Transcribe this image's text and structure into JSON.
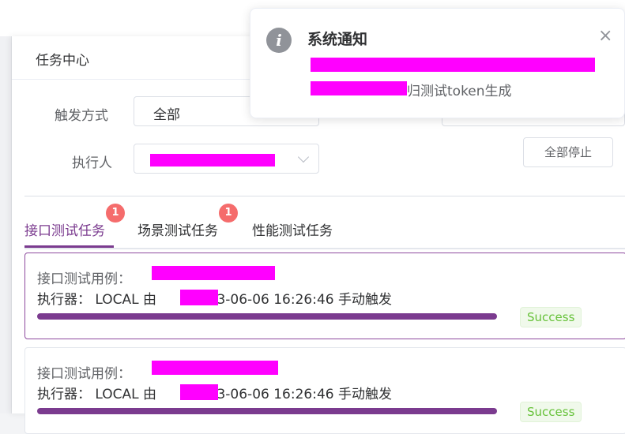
{
  "drawer": {
    "title": "任务中心",
    "filters": {
      "trigger_label": "触发方式",
      "trigger_value": "全部",
      "executor_label": "执行人",
      "executor_value": ""
    },
    "stop_all_label": "全部停止"
  },
  "tabs": [
    {
      "label": "接口测试任务",
      "badge": "1",
      "active": true
    },
    {
      "label": "场景测试任务",
      "badge": "1",
      "active": false
    },
    {
      "label": "性能测试任务",
      "badge": "",
      "active": false
    }
  ],
  "tasks": [
    {
      "case_label": "接口测试用例：",
      "executor_prefix": "执行器：  LOCAL 由",
      "executor_suffix": "2023-06-06 16:26:46 手动触发",
      "progress": 1.0,
      "status": "Success"
    },
    {
      "case_label": "接口测试用例：",
      "executor_prefix": "执行器：  LOCAL 由",
      "executor_suffix": "2023-06-06 16:26:46 手动触发",
      "progress": 1.0,
      "status": "Success"
    }
  ],
  "notification": {
    "title": "系统通知",
    "message_visible": "归测试token生成",
    "close_glyph": "×",
    "icon_glyph": "i"
  },
  "colors": {
    "accent": "#7b3b8f",
    "badge": "#f56c6c",
    "success": "#67c23a",
    "redaction": "#ff00ff"
  }
}
